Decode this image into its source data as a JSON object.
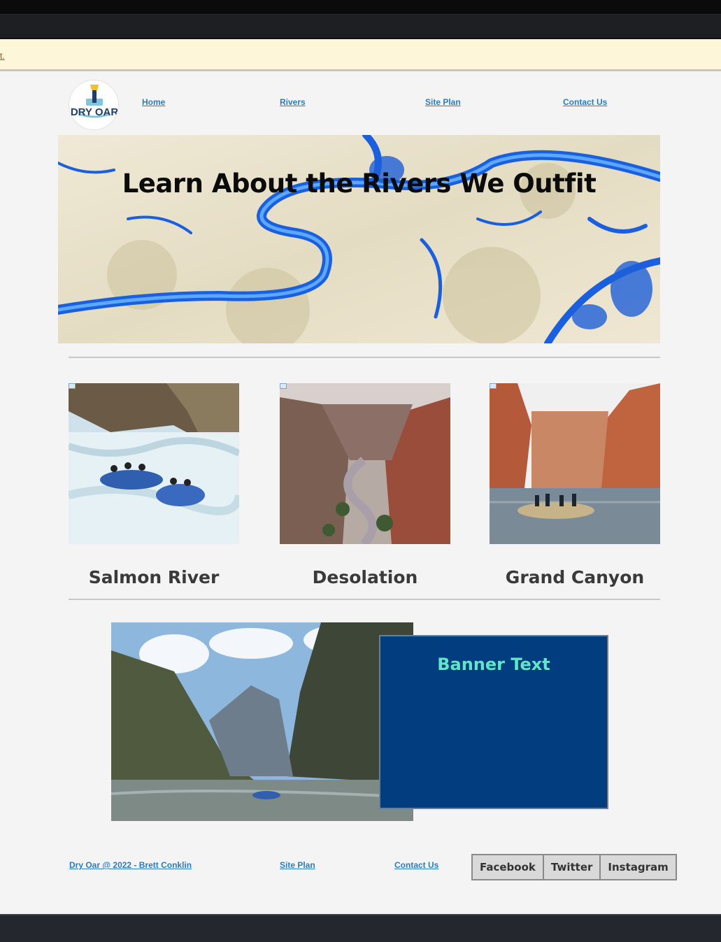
{
  "browser": {
    "notice_link": "t."
  },
  "nav": {
    "logo_text": "DRY OAR",
    "items": [
      {
        "label": "Home"
      },
      {
        "label": "Rivers"
      },
      {
        "label": "Site Plan"
      },
      {
        "label": "Contact Us"
      }
    ]
  },
  "hero": {
    "title": "Learn About the Rivers We Outfit"
  },
  "rivers": [
    {
      "name": "Salmon River"
    },
    {
      "name": "Desolation"
    },
    {
      "name": "Grand Canyon"
    }
  ],
  "feature": {
    "banner_title": "Banner Text"
  },
  "footer": {
    "copyright": "Dry Oar @ 2022 - Brett Conklin",
    "site_plan": "Site Plan",
    "contact": "Contact Us",
    "social": [
      "Facebook",
      "Twitter",
      "Instagram"
    ]
  },
  "colors": {
    "link": "#2a7bc0",
    "banner_bg": "#023d7f",
    "banner_text": "#5fe6c6",
    "notice_bg": "#fdf6d8"
  }
}
